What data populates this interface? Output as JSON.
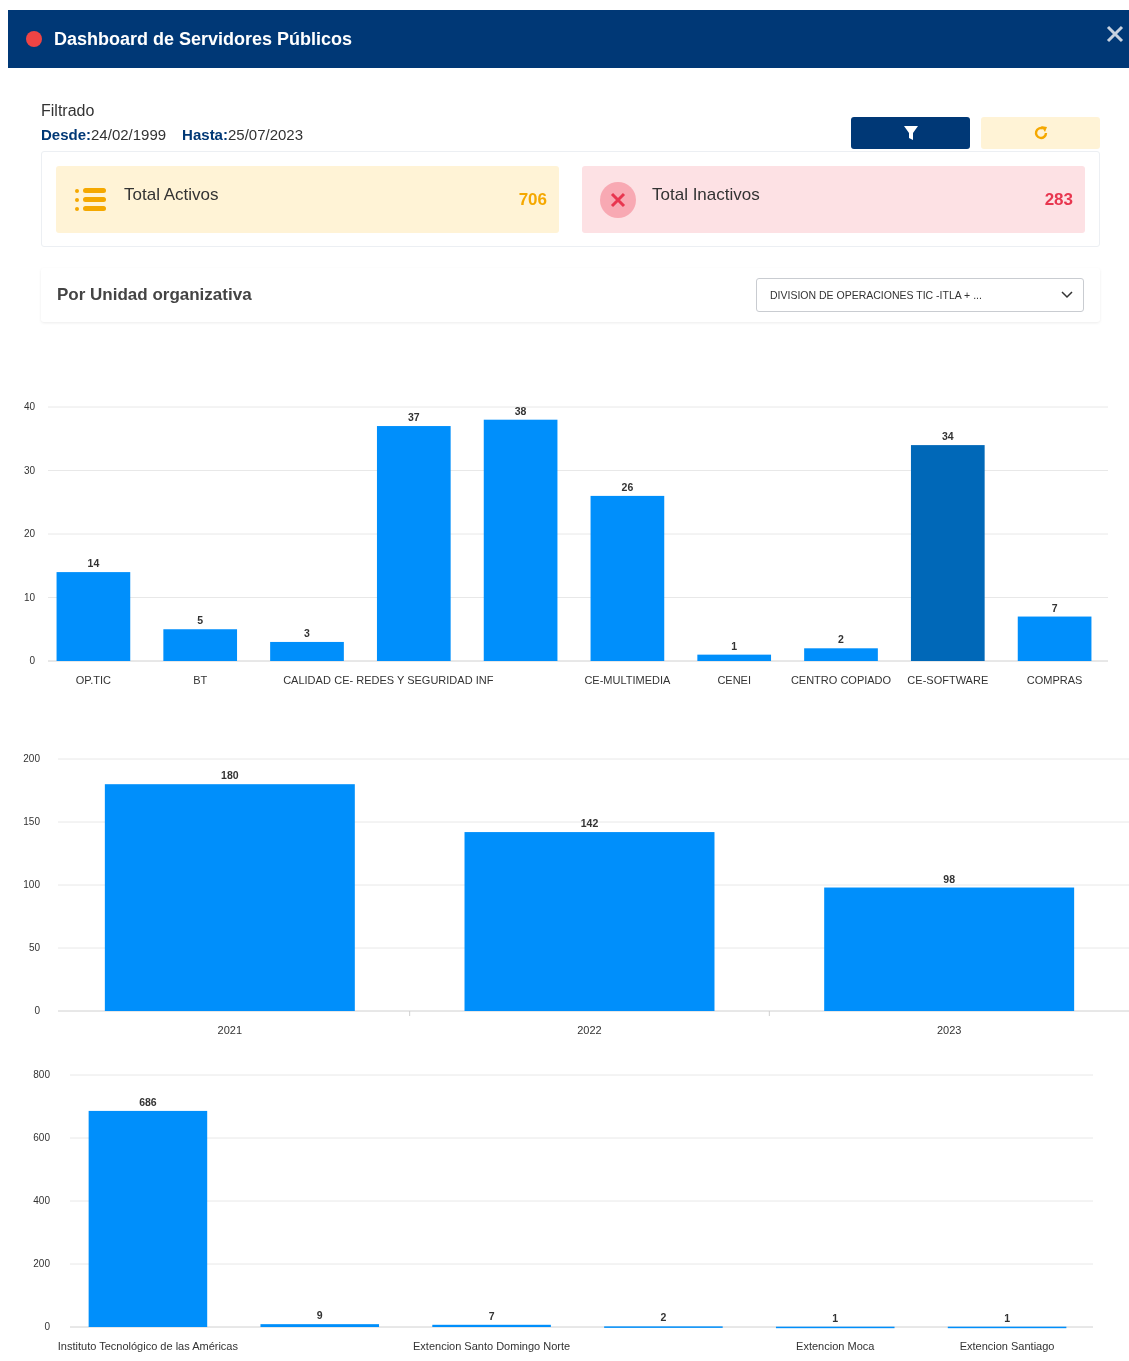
{
  "window": {
    "title": "Dashboard de Servidores Públicos"
  },
  "filter": {
    "title": "Filtrado",
    "from_label": "Desde:",
    "from_value": "24/02/1999",
    "to_label": "Hasta:",
    "to_value": "25/07/2023"
  },
  "stats": [
    {
      "kind": "active",
      "label": "Total Activos",
      "value": "706"
    },
    {
      "kind": "inactive",
      "label": "Total Inactivos",
      "value": "283"
    }
  ],
  "unit_section": {
    "title": "Por Unidad organizativa",
    "select_value": "DIVISION DE OPERACIONES TIC -ITLA + ..."
  },
  "charts": [
    {
      "chart_data": {
        "type": "bar",
        "categories": [
          "OP.TIC",
          "BT",
          "CALIDAD",
          "CE- REDES Y SEGURIDAD INF",
          null,
          "CE-MULTIMEDIA",
          "CENEI",
          "CENTRO COPIADO",
          "CE-SOFTWARE",
          "COMPRAS"
        ],
        "series": [
          {
            "color": "#008ffb",
            "values": [
              14,
              5,
              3,
              37,
              38,
              26,
              1,
              2,
              null,
              7
            ]
          },
          {
            "color": "#0068b8",
            "values": [
              null,
              null,
              null,
              null,
              null,
              null,
              null,
              null,
              34,
              null
            ]
          }
        ],
        "stacked": true,
        "ylim": [
          0,
          40
        ],
        "yticks": [
          0,
          10,
          20,
          30,
          40
        ],
        "grid": true,
        "data_labels": true
      }
    },
    {
      "chart_data": {
        "type": "bar",
        "categories": [
          "2021",
          "2022",
          "2023"
        ],
        "series": [
          {
            "color": "#008ffb",
            "values": [
              180,
              142,
              98
            ]
          }
        ],
        "ylim": [
          0,
          200
        ],
        "yticks": [
          0,
          50,
          100,
          150,
          200
        ],
        "grid": true,
        "data_labels": true
      }
    },
    {
      "chart_data": {
        "type": "bar",
        "categories": [
          "Instituto Tecnológico de las Américas",
          null,
          "Extencion Santo Domingo Norte",
          null,
          "Extencion Moca",
          "Extencion Santiago"
        ],
        "series": [
          {
            "color": "#008ffb",
            "values": [
              686,
              9,
              7,
              2,
              1,
              1
            ]
          }
        ],
        "ylim": [
          0,
          800
        ],
        "yticks": [
          0,
          200,
          400,
          600,
          800
        ],
        "grid": true,
        "data_labels": true
      }
    }
  ]
}
